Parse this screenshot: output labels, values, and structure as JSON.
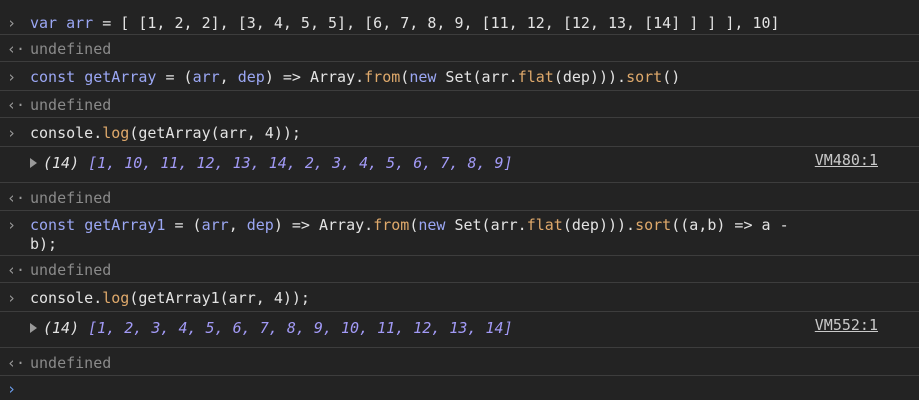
{
  "rows": {
    "r1": {
      "kw": "var",
      "name": "arr",
      "rest": " = [ [1, 2, 2], [3, 4, 5, 5], [6, 7, 8, 9, [11, 12, [12, 13, [14] ] ] ], 10]"
    },
    "r2": {
      "text": "undefined"
    },
    "r3": {
      "kw1": "const",
      "name": "getArray",
      "p1": " = (",
      "a1": "arr",
      "p2": ", ",
      "a2": "dep",
      "p3": ") => ",
      "cls": "Array",
      "p4": ".",
      "m1": "from",
      "p5": "(",
      "kw2": "new",
      "p6": " Set(arr.",
      "m2": "flat",
      "p7": "(dep))).",
      "m3": "sort",
      "p8": "()"
    },
    "r4": {
      "text": "undefined"
    },
    "r5": {
      "obj": "console.",
      "m": "log",
      "args": "(getArray(arr, 4));"
    },
    "r6": {
      "count": "(14)",
      "items": "[1, 10, 11, 12, 13, 14, 2, 3, 4, 5, 6, 7, 8, 9]",
      "source": "VM480:1"
    },
    "r7": {
      "text": "undefined"
    },
    "r8": {
      "kw1": "const",
      "name": "getArray1",
      "p1": " = (",
      "a1": "arr",
      "p2": ", ",
      "a2": "dep",
      "p3": ") => ",
      "cls": "Array",
      "p4": ".",
      "m1": "from",
      "p5": "(",
      "kw2": "new",
      "p6": " Set(arr.",
      "m2": "flat",
      "p7": "(dep))).",
      "m3": "sort",
      "p8": "((a,b) => a -",
      "line2": "b);"
    },
    "r9": {
      "text": "undefined"
    },
    "r10": {
      "obj": "console.",
      "m": "log",
      "args": "(getArray1(arr, 4));"
    },
    "r11": {
      "count": "(14)",
      "items": "[1, 2, 3, 4, 5, 6, 7, 8, 9, 10, 11, 12, 13, 14]",
      "source": "VM552:1"
    },
    "r12": {
      "text": "undefined"
    }
  },
  "icons": {
    "input": "chevron-right-icon",
    "return": "return-arrow-icon",
    "expand": "expand-triangle-icon",
    "prompt": "prompt-caret-icon"
  },
  "glyphs": {
    "input": "›",
    "return": "‹·",
    "prompt": "›"
  },
  "colors": {
    "background": "#232323",
    "keyword": "#9ba7f4",
    "number": "#9b9bff",
    "method": "#dfa96b",
    "muted": "#8a8a8a",
    "prompt": "#6da0f0"
  }
}
